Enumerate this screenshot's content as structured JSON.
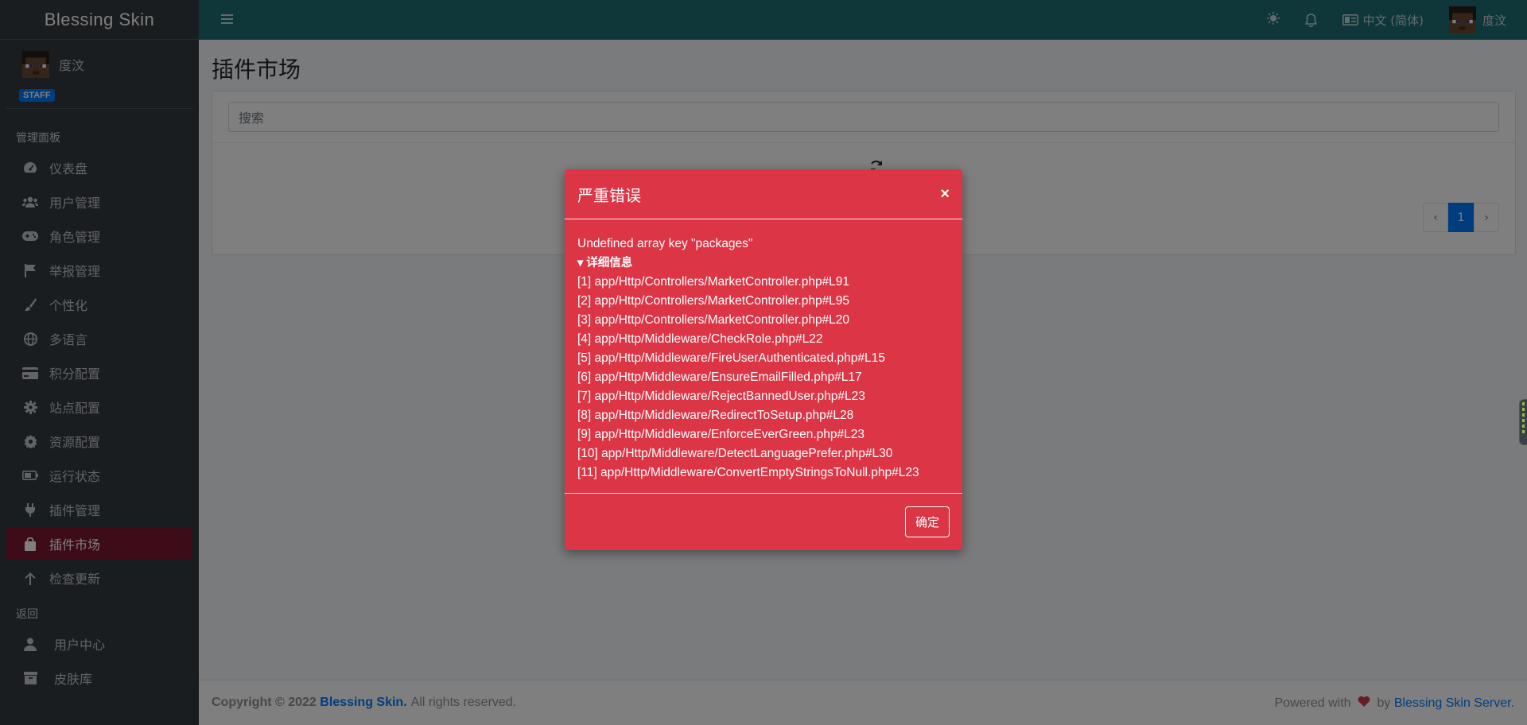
{
  "brand": "Blessing Skin",
  "user": {
    "name": "度汶",
    "badge": "STAFF"
  },
  "sidebar": {
    "section_admin": "管理面板",
    "items": [
      {
        "label": "仪表盘",
        "icon": "tachometer-icon"
      },
      {
        "label": "用户管理",
        "icon": "users-icon"
      },
      {
        "label": "角色管理",
        "icon": "gamepad-icon"
      },
      {
        "label": "举报管理",
        "icon": "flag-icon"
      },
      {
        "label": "个性化",
        "icon": "paint-brush-icon"
      },
      {
        "label": "多语言",
        "icon": "globe-icon"
      },
      {
        "label": "积分配置",
        "icon": "credit-card-icon"
      },
      {
        "label": "站点配置",
        "icon": "gear-icon"
      },
      {
        "label": "资源配置",
        "icon": "gear-alt-icon"
      },
      {
        "label": "运行状态",
        "icon": "battery-icon"
      },
      {
        "label": "插件管理",
        "icon": "plug-icon"
      },
      {
        "label": "插件市场",
        "icon": "shopping-bag-icon",
        "active": true
      },
      {
        "label": "检查更新",
        "icon": "arrow-up-icon"
      }
    ],
    "section_back": "返回",
    "back_items": [
      {
        "label": "用户中心",
        "icon": "user-icon"
      },
      {
        "label": "皮肤库",
        "icon": "archive-icon"
      }
    ]
  },
  "topbar": {
    "language": "中文 (简体)",
    "user_name": "度汶"
  },
  "page": {
    "title": "插件市场",
    "search_placeholder": "搜索",
    "pagination": {
      "prev": "‹",
      "current": "1",
      "next": "›"
    }
  },
  "footer": {
    "copyright_prefix": "Copyright © 2022",
    "copyright_link": "Blessing Skin.",
    "copyright_suffix": "All rights reserved.",
    "powered_prefix": "Powered with",
    "powered_by": "by",
    "powered_link": "Blessing Skin Server."
  },
  "modal": {
    "title": "严重错误",
    "close": "×",
    "message": "Undefined array key \"packages\"",
    "details_label": "▾ 详细信息",
    "trace": [
      "[1] app/Http/Controllers/MarketController.php#L91",
      "[2] app/Http/Controllers/MarketController.php#L95",
      "[3] app/Http/Controllers/MarketController.php#L20",
      "[4] app/Http/Middleware/CheckRole.php#L22",
      "[5] app/Http/Middleware/FireUserAuthenticated.php#L15",
      "[6] app/Http/Middleware/EnsureEmailFilled.php#L17",
      "[7] app/Http/Middleware/RejectBannedUser.php#L23",
      "[8] app/Http/Middleware/RedirectToSetup.php#L28",
      "[9] app/Http/Middleware/EnforceEverGreen.php#L23",
      "[10] app/Http/Middleware/DetectLanguagePrefer.php#L30",
      "[11] app/Http/Middleware/ConvertEmptyStringsToNull.php#L23"
    ],
    "ok_label": "确定"
  },
  "colors": {
    "sidebar_bg": "#343a40",
    "topbar_bg": "#1e6f75",
    "active_item": "#7d1732",
    "modal_bg": "#dc3545",
    "link": "#007bff"
  }
}
